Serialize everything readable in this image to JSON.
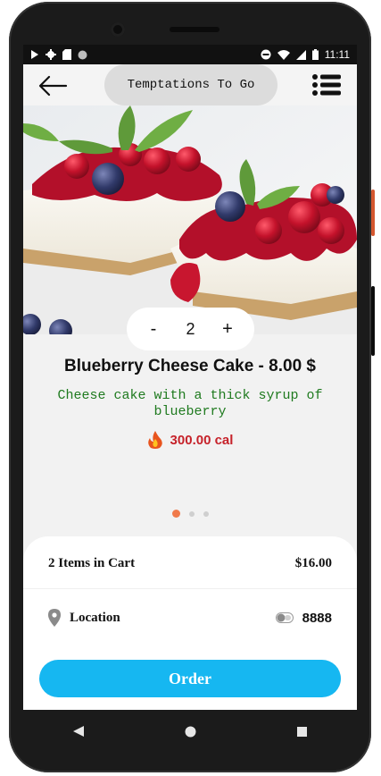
{
  "status_bar": {
    "time": "11:11",
    "left_icons": [
      "play-icon",
      "gear-icon",
      "sdcard-icon",
      "circle-icon"
    ],
    "right_icons": [
      "dnd-icon",
      "wifi-icon",
      "signal-icon",
      "battery-icon"
    ]
  },
  "header": {
    "title": "Temptations To Go",
    "back_icon": "arrow-left-icon",
    "menu_icon": "list-menu-icon"
  },
  "product": {
    "quantity": "2",
    "decrement_label": "-",
    "increment_label": "+",
    "name_price": "Blueberry Cheese Cake - 8.00 $",
    "description": "Cheese cake with a thick syrup of blueberry",
    "calories": "300.00 cal",
    "calories_icon": "fire-icon"
  },
  "carousel": {
    "count": 3,
    "active_index": 0,
    "active_color": "#f07a4b"
  },
  "cart": {
    "items_label": "2 Items in Cart",
    "total": "$16.00",
    "location_label": "Location",
    "location_icon": "map-pin-icon",
    "toggle_icon": "toggle-icon",
    "location_code": "8888"
  },
  "order_button": {
    "label": "Order",
    "color": "#16b7f1"
  },
  "colors": {
    "description_text": "#1f7a1f",
    "calories_text": "#c6222a"
  }
}
